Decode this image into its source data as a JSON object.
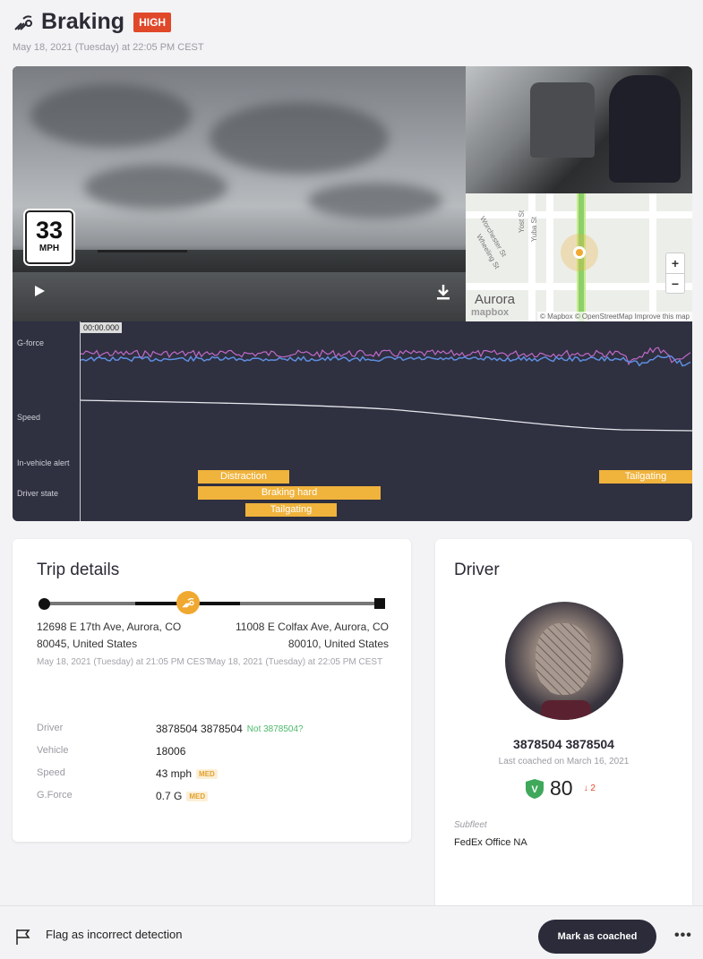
{
  "event": {
    "title": "Braking",
    "severity": "HIGH",
    "timestamp": "May 18, 2021 (Tuesday) at 22:05 PM CEST"
  },
  "video": {
    "speed_value": "33",
    "speed_unit": "MPH"
  },
  "map": {
    "city_label": "Aurora",
    "streets": [
      "Worchester St",
      "Wheeling St",
      "Yost St",
      "Yuba St"
    ],
    "zoom_in": "+",
    "zoom_out": "−",
    "attribution": "© Mapbox © OpenStreetMap Improve this map",
    "logo": "mapbox"
  },
  "timeline": {
    "timecode": "00:00.000",
    "rows": {
      "gforce": "G-force",
      "speed": "Speed",
      "alert": "In-vehicle alert",
      "driver_state": "Driver state"
    },
    "bars": [
      {
        "label": "Distraction",
        "row": 0
      },
      {
        "label": "Braking hard",
        "row": 1
      },
      {
        "label": "Tailgating",
        "row": 2
      },
      {
        "label": "Tailgating",
        "row": 0
      }
    ]
  },
  "trip": {
    "title": "Trip details",
    "start_address": "12698 E 17th Ave, Aurora, CO 80045, United States",
    "start_time": "May 18, 2021 (Tuesday) at 21:05 PM CEST",
    "end_address": "11008 E Colfax Ave, Aurora, CO 80010, United States",
    "end_time": "May 18, 2021 (Tuesday) at 22:05 PM CEST",
    "details": {
      "driver_label": "Driver",
      "driver_value": "3878504 3878504",
      "driver_link": "Not 3878504?",
      "vehicle_label": "Vehicle",
      "vehicle_value": "18006",
      "speed_label": "Speed",
      "speed_value": "43 mph",
      "speed_badge": "MED",
      "gforce_label": "G.Force",
      "gforce_value": "0.7 G",
      "gforce_badge": "MED"
    }
  },
  "driver": {
    "title": "Driver",
    "name": "3878504 3878504",
    "last_coached": "Last coached on March 16, 2021",
    "score": "80",
    "score_badge": "V",
    "score_delta": "2",
    "subfleet_label": "Subfleet",
    "subfleet_value": "FedEx Office NA"
  },
  "footer": {
    "flag_label": "Flag as incorrect detection",
    "coach_button": "Mark as coached",
    "more": "•••"
  },
  "colors": {
    "severity": "#e0482a",
    "event_orange": "#f0b33c",
    "timeline_bg": "#2f3040",
    "gforce_pink": "#c069c8",
    "gforce_blue": "#5e8fe0",
    "score_green": "#3fa85a",
    "link_green": "#4cb86a"
  }
}
